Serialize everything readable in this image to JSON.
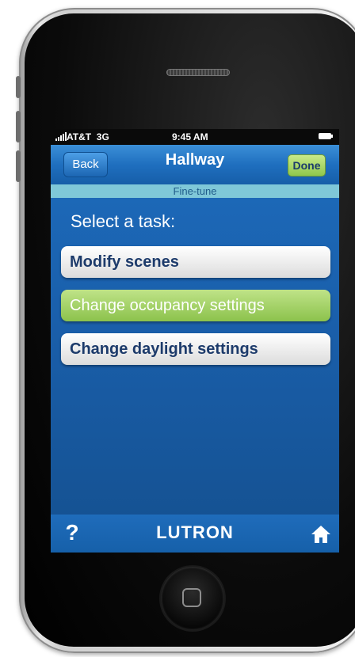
{
  "status": {
    "carrier": "AT&T",
    "network": "3G",
    "time": "9:45 AM"
  },
  "nav": {
    "back_label": "Back",
    "title": "Hallway",
    "done_label": "Done",
    "subtitle": "Fine-tune"
  },
  "main": {
    "prompt": "Select a task:",
    "tasks": [
      {
        "label": "Modify scenes",
        "selected": false
      },
      {
        "label": "Change occupancy settings",
        "selected": true
      },
      {
        "label": "Change daylight settings",
        "selected": false
      }
    ]
  },
  "footer": {
    "help_label": "?",
    "brand": "LUTRON",
    "home_icon": "home-icon"
  },
  "colors": {
    "screen_bg": "#1a5fab",
    "accent_green": "#8cc24c",
    "button_text": "#1d3b6b"
  }
}
